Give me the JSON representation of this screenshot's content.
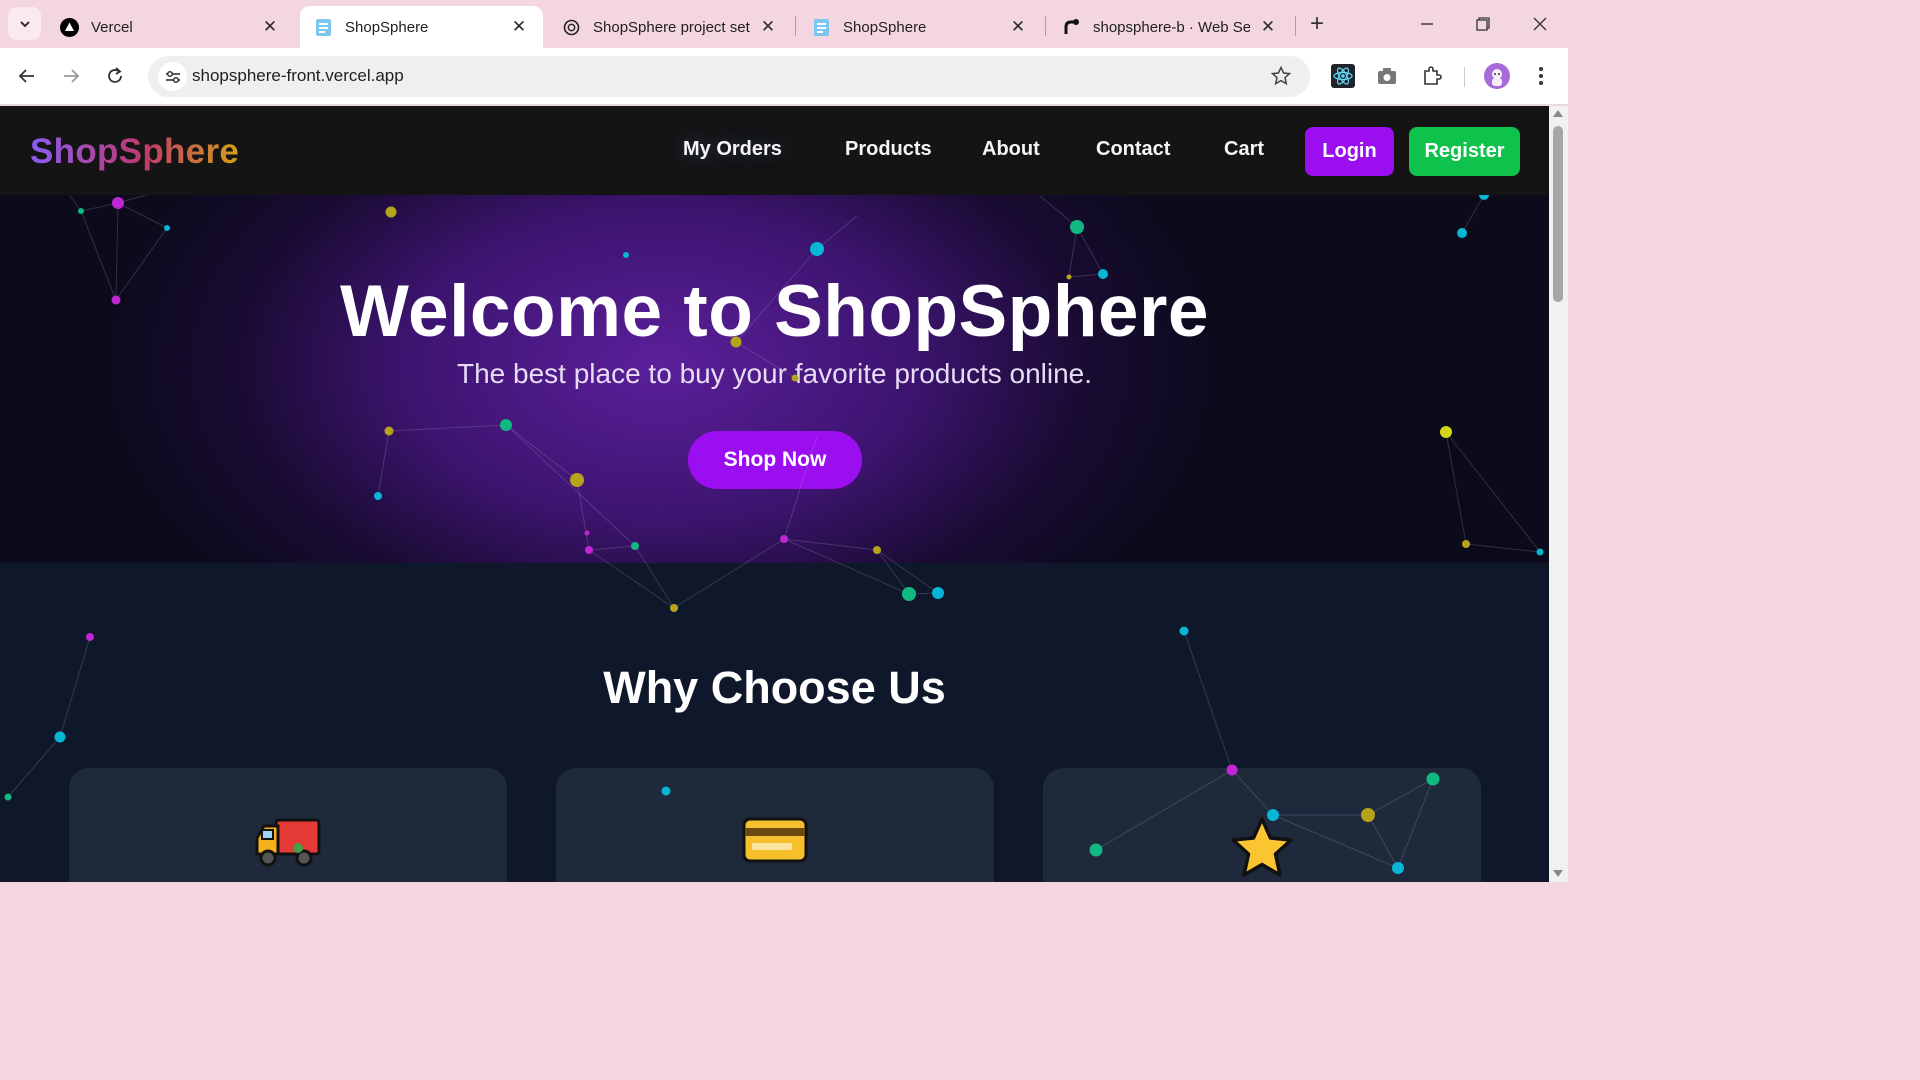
{
  "browser": {
    "tabs": [
      {
        "title": "Vercel",
        "icon": "vercel-triangle-icon",
        "active": false
      },
      {
        "title": "ShopSphere",
        "icon": "page-doc-icon",
        "active": true
      },
      {
        "title": "ShopSphere project setup",
        "icon": "openai-icon",
        "active": false
      },
      {
        "title": "ShopSphere",
        "icon": "page-doc-icon",
        "active": false
      },
      {
        "title": "shopsphere-b · Web Service",
        "icon": "render-icon",
        "active": false
      }
    ],
    "url": "shopsphere-front.vercel.app"
  },
  "navbar": {
    "brand": "ShopSphere",
    "links": [
      "My Orders",
      "Products",
      "About",
      "Contact",
      "Cart"
    ],
    "login_label": "Login",
    "register_label": "Register"
  },
  "hero": {
    "title": "Welcome to ShopSphere",
    "subtitle": "The best place to buy your favorite products online.",
    "cta_label": "Shop Now"
  },
  "features": {
    "title": "Why Choose Us",
    "cards": [
      {
        "icon": "delivery-truck-icon"
      },
      {
        "icon": "credit-card-icon"
      },
      {
        "icon": "star-icon"
      }
    ]
  },
  "colors": {
    "accent_purple": "#9b0ef0",
    "register_green": "#0ec24b",
    "page_bg": "#0f172a",
    "card_bg": "#1e293b"
  }
}
